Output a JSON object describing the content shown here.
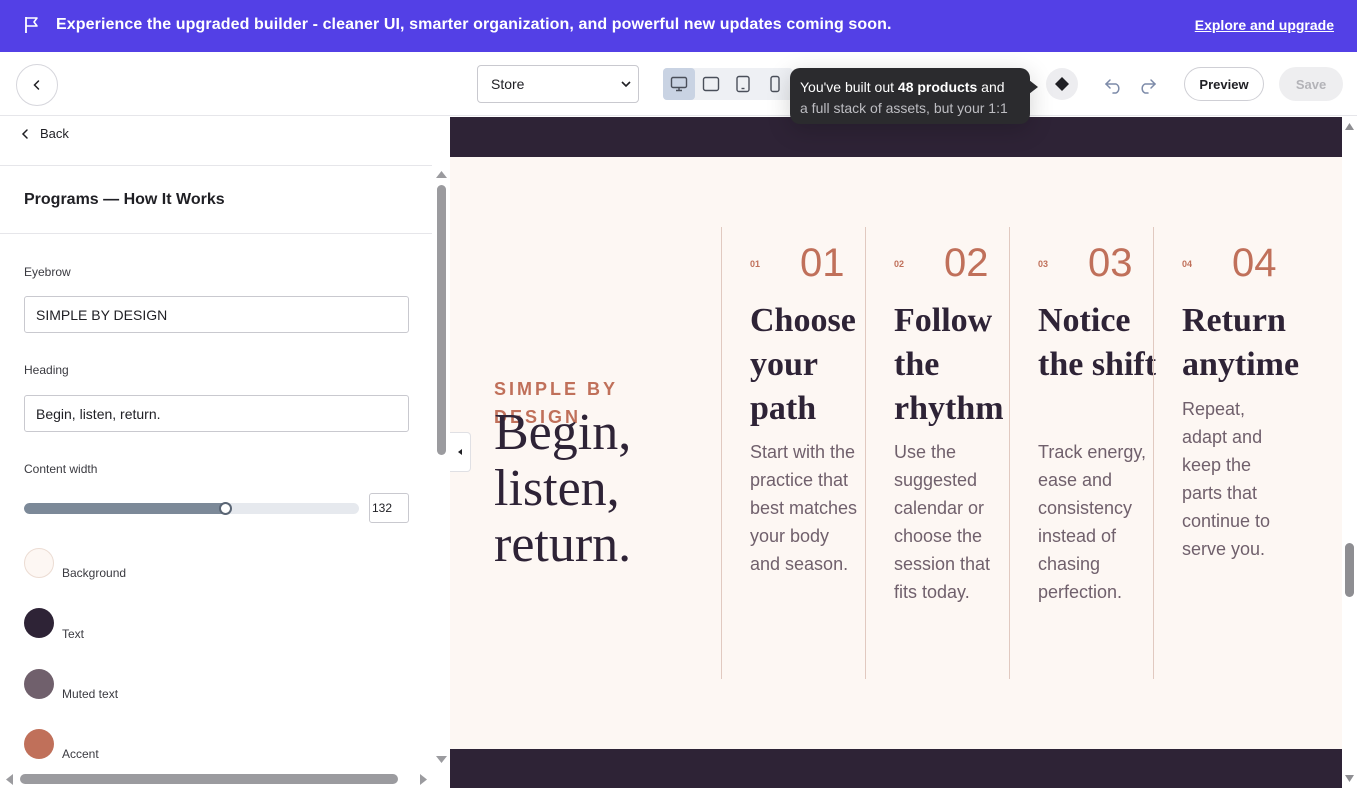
{
  "banner": {
    "message": "Experience the upgraded builder - cleaner UI, smarter organization, and powerful new updates coming soon.",
    "link": "Explore and upgrade"
  },
  "toolbar": {
    "store_select": "Store",
    "tooltip_prefix": "You've built out ",
    "tooltip_bold": "48 products",
    "tooltip_suffix": " and",
    "tooltip_line2": "a full stack of assets, but your 1:1",
    "preview_label": "Preview",
    "save_label": "Save",
    "devices": [
      "desktop-icon",
      "tablet-landscape-icon",
      "tablet-portrait-icon",
      "mobile-icon"
    ]
  },
  "sidebar": {
    "back_label": "Back",
    "section_title": "Programs — How It Works",
    "eyebrow_label": "Eyebrow",
    "eyebrow_value": "SIMPLE BY DESIGN",
    "heading_label": "Heading",
    "heading_value": "Begin, listen, return.",
    "content_width_label": "Content width",
    "content_width_value": "132",
    "content_width_fraction": 0.6,
    "colors": [
      {
        "label": "Background",
        "hex": "#fdf7f3"
      },
      {
        "label": "Text",
        "hex": "#2e2336"
      },
      {
        "label": "Muted text",
        "hex": "#70606c"
      },
      {
        "label": "Accent",
        "hex": "#c0705a"
      }
    ]
  },
  "canvas": {
    "eyebrow": "SIMPLE BY DESIGN",
    "heading_lines": [
      "Begin,",
      "listen,",
      "return."
    ],
    "steps": [
      {
        "small": "01",
        "big": "01",
        "title": "Choose your path",
        "body": "Start with the practice that best matches your body and season."
      },
      {
        "small": "02",
        "big": "02",
        "title": "Follow the rhythm",
        "body": "Use the suggested calendar or choose the session that fits today."
      },
      {
        "small": "03",
        "big": "03",
        "title": "Notice the shift",
        "body": "Track energy, ease and consistency instead of chasing perfection."
      },
      {
        "small": "04",
        "big": "04",
        "title": "Return anytime",
        "body": "Repeat, adapt and keep the parts that continue to serve you."
      }
    ]
  },
  "colors": {
    "banner": "#5340e6",
    "dark_band": "#2e2336",
    "accent": "#c0705a"
  }
}
